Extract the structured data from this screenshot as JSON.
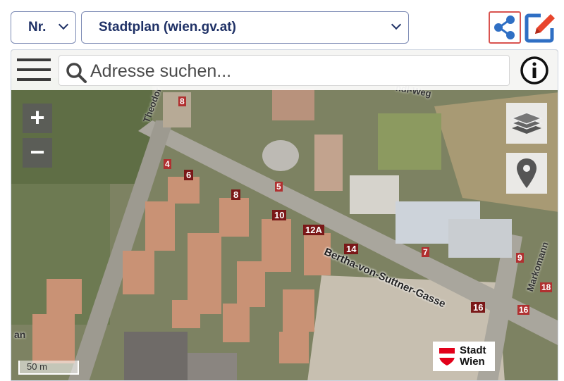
{
  "top": {
    "number_select": "Nr.",
    "map_select": "Stadtplan (wien.gv.at)"
  },
  "icons": {
    "share": "share-icon",
    "edit": "external-edit-icon",
    "menu": "hamburger-menu-icon",
    "search": "search-icon",
    "info": "info-icon",
    "layers": "layers-icon",
    "locate": "location-pin-icon"
  },
  "search": {
    "placeholder": "Adresse suchen..."
  },
  "zoom": {
    "in": "+",
    "out": "−"
  },
  "scale": {
    "label": "50 m"
  },
  "logo": {
    "line1": "Stadt",
    "line2": "Wien"
  },
  "map_labels": {
    "street_main": "Bertha-von-Suttner-Gasse",
    "street_theodor": "Theodor",
    "street_weg": "ndl-Weg",
    "street_markomann": "Markomann",
    "street_an": "an",
    "house_numbers": [
      "4",
      "6",
      "8",
      "10",
      "12A",
      "14",
      "5",
      "7",
      "8",
      "9",
      "16",
      "16",
      "18"
    ]
  },
  "colors": {
    "select_text": "#1f3166",
    "share_border": "#d9534f",
    "edit_red": "#e8452c",
    "edit_blue": "#2f6fc4",
    "vienna_red": "#e2001a"
  }
}
